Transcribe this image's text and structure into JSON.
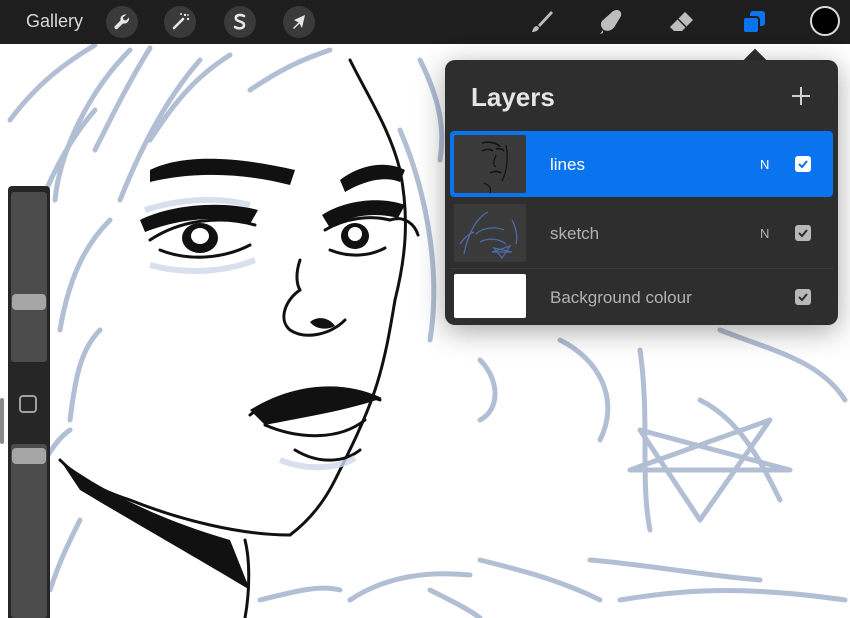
{
  "toolbar": {
    "gallery_label": "Gallery",
    "left_buttons": [
      {
        "name": "actions",
        "icon": "wrench-icon"
      },
      {
        "name": "adjustments",
        "icon": "magic-wand-icon"
      },
      {
        "name": "selection",
        "icon": "selection-s-icon"
      },
      {
        "name": "transform",
        "icon": "arrow-cursor-icon"
      }
    ],
    "tools": [
      {
        "name": "brush",
        "icon": "brush-icon"
      },
      {
        "name": "smudge",
        "icon": "smudge-finger-icon"
      },
      {
        "name": "eraser",
        "icon": "eraser-icon"
      },
      {
        "name": "layers",
        "icon": "layers-icon",
        "active": true
      }
    ],
    "current_color": "#000000"
  },
  "sidebar": {
    "brush_size_level": 0.65,
    "opacity_level": 0.95,
    "modify_icon": "square-icon"
  },
  "layers_panel": {
    "title": "Layers",
    "add_icon": "plus-icon",
    "layers": [
      {
        "name": "lines",
        "blend": "N",
        "visible": true,
        "active": true
      },
      {
        "name": "sketch",
        "blend": "N",
        "visible": true,
        "active": false
      },
      {
        "name": "Background colour",
        "blend": "",
        "visible": true,
        "active": false
      }
    ]
  },
  "colors": {
    "accent": "#0a74ef",
    "panel": "#2e2e2e",
    "sketch_lines": "#a7b5cf"
  }
}
